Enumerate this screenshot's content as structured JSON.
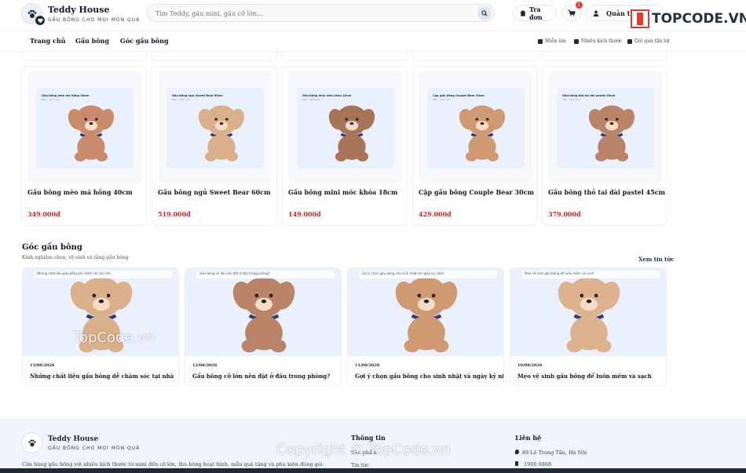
{
  "brand": {
    "name": "Teddy House",
    "tagline": "GẤU BÔNG CHO MỌI MÓN QUÀ"
  },
  "search": {
    "placeholder": "Tìm Teddy, gấu mini, gấu cỡ lớn..."
  },
  "header": {
    "order_label": "Tra đơn",
    "cart_count": "1",
    "account_label": "Quản trị"
  },
  "watermark": {
    "logo_text": "TOPCODE.VN",
    "mid_text": "TopCode.vn",
    "copyright": "Copyright © TopCode.vn"
  },
  "nav": {
    "items": [
      "Trang chủ",
      "Gấu bông",
      "Góc gấu bông"
    ],
    "perks": [
      "Miễn êm",
      "Nhiều kích thước",
      "Gói quà tận lợi"
    ]
  },
  "products": [
    {
      "name": "Gấu bông mèo má hồng 40cm",
      "price": "349.000đ",
      "img_title": "Gấu bông mèo má hồng 40cm",
      "img_sub": "Mẫu · Hình ảnh",
      "color": "#c98b6b"
    },
    {
      "name": "Gấu bông ngủ Sweet Bear 60cm",
      "price": "519.000đ",
      "img_title": "Gấu bông ngủ Sweet Bear 60cm",
      "img_sub": "Mẫu · Hình ảnh",
      "color": "#d9b08a"
    },
    {
      "name": "Gấu bông mini móc khóa 18cm",
      "price": "149.000đ",
      "img_title": "Gấu bông mini móc khóa 18cm",
      "img_sub": "Mẫu · Hình ảnh",
      "color": "#a87458"
    },
    {
      "name": "Cặp gấu bông Couple Bear 30cm",
      "price": "429.000đ",
      "img_title": "Cặp gấu bông Couple Bear 30cm",
      "img_sub": "Mẫu · Hình ảnh",
      "color": "#cf9a72"
    },
    {
      "name": "Gấu bông thỏ tai dài pastel 45cm",
      "price": "379.000đ",
      "img_title": "Gấu bông thỏ tai dài pastel 45cm",
      "img_sub": "Mẫu · Hình ảnh",
      "color": "#b98467"
    }
  ],
  "blog": {
    "title": "Góc gấu bông",
    "subtitle": "Kinh nghiệm chọn, vệ sinh và tặng gấu bông",
    "see_all": "Xem tin tức",
    "posts": [
      {
        "date": "13/08/2026",
        "title": "Những chất liệu gấu bông dễ chăm sóc tại nhà",
        "img_caption": "Những chất liệu gấu bông dễ chăm sóc tại nhà",
        "color": "#d9b08a"
      },
      {
        "date": "12/08/2026",
        "title": "Gấu bông cỡ lớn nên đặt ở đâu trong phòng?",
        "img_caption": "Gấu bông cỡ lớn nên đặt ở đâu trong phòng?",
        "color": "#b98467"
      },
      {
        "date": "11/08/2026",
        "title": "Gợi ý chọn gấu bông cho sinh nhật và ngày kỷ niệm",
        "img_caption": "Gợi ý chọn gấu bông cho sinh nhật và ngày kỷ niệm",
        "color": "#cf9a72"
      },
      {
        "date": "10/08/2026",
        "title": "Mẹo vệ sinh gấu bông để luôn mềm và sạch",
        "img_caption": "Mẹo vệ sinh gấu bông để luôn mềm và sạch",
        "color": "#ddb38f"
      }
    ]
  },
  "footer": {
    "name": "Teddy House",
    "tagline": "GẤU BÔNG CHO MỌI MÓN QUÀ",
    "description": "Cửa hàng gấu bông với nhiều kích thước từ mini đến cỡ lớn, thú bông hoạt hình, mẫu quà tặng và phụ kiện đóng gói.",
    "info_title": "Thông tin",
    "info_links": [
      "Sản phẩm",
      "Tin tức"
    ],
    "contact_title": "Liên hệ",
    "address": "88 Lê Trọng Tấn, Hà Nội",
    "phone": "1900 6868"
  }
}
